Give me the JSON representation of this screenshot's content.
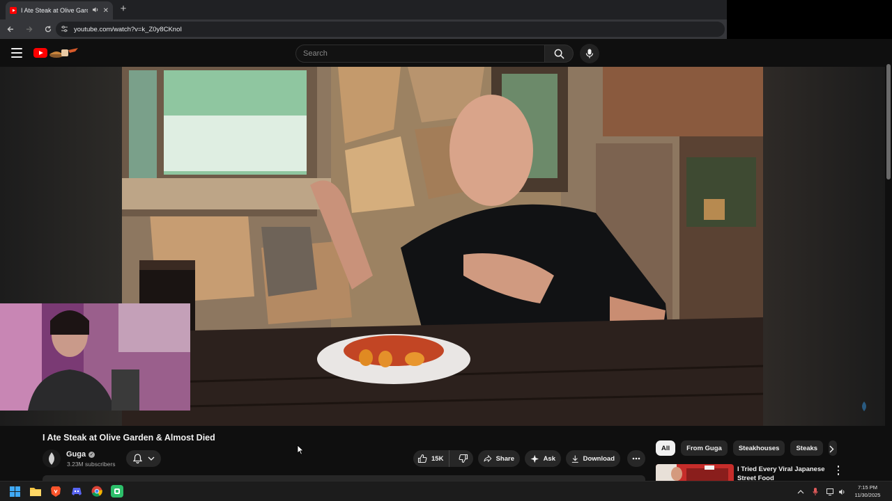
{
  "browser": {
    "tab_title": "I Ate Steak at Olive Garden",
    "url": "youtube.com/watch?v=k_Z0y8CKnoI"
  },
  "youtube": {
    "search_placeholder": "Search"
  },
  "video": {
    "title": "I Ate Steak at Olive Garden & Almost Died",
    "channel": "Guga",
    "subscribers": "3.23M subscribers",
    "likes": "15K",
    "share_label": "Share",
    "ask_label": "Ask",
    "download_label": "Download"
  },
  "chips": [
    {
      "label": "All",
      "active": true
    },
    {
      "label": "From Guga",
      "active": false
    },
    {
      "label": "Steakhouses",
      "active": false
    },
    {
      "label": "Steaks",
      "active": false
    }
  ],
  "recommendation": {
    "title": "I Tried Every Viral Japanese Street Food"
  },
  "taskbar": {
    "time": "7:15 PM",
    "date": "11/30/2025"
  },
  "colors": {
    "yt_red": "#ff0000",
    "background": "#0f0f0f",
    "pill": "#272727"
  }
}
